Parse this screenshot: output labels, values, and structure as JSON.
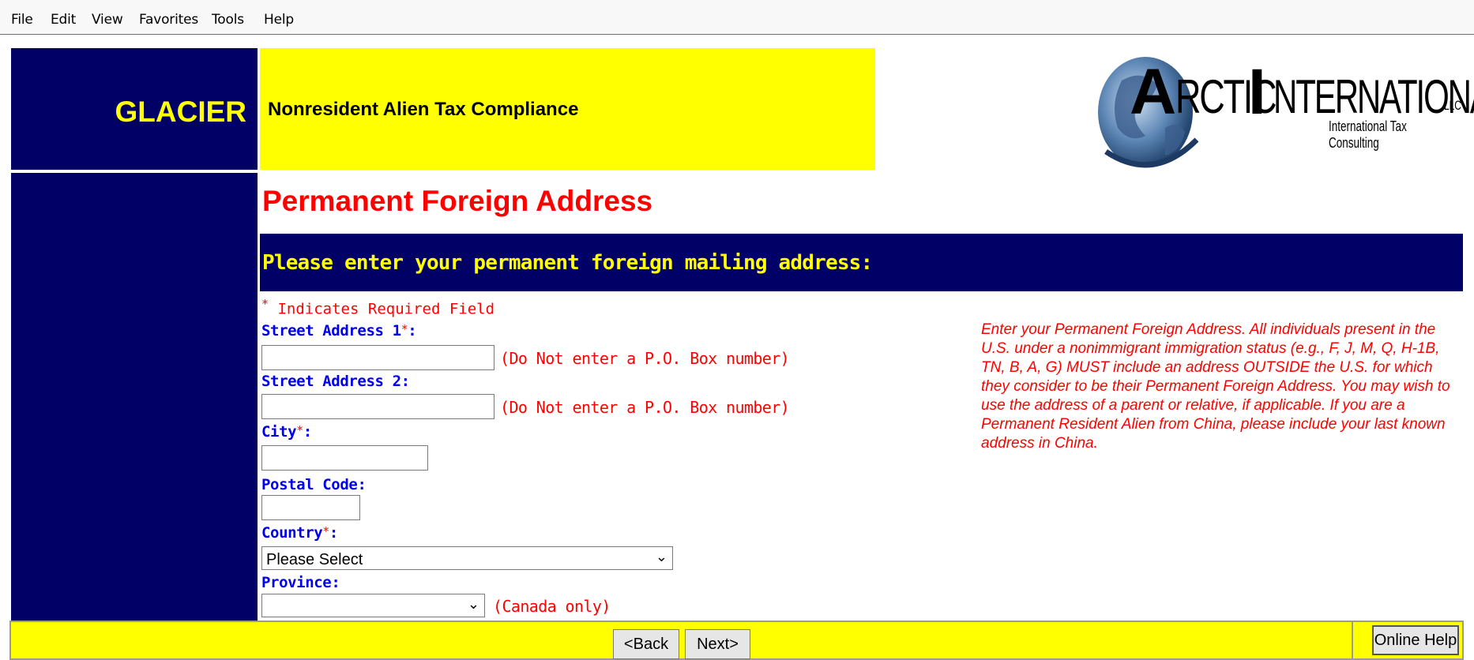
{
  "menubar": {
    "items": [
      "File",
      "Edit",
      "View",
      "Favorites",
      "Tools",
      "Help"
    ]
  },
  "header": {
    "brand": "GLACIER",
    "tagline": "Nonresident Alien Tax Compliance",
    "logo": {
      "name_big": "RCTIC",
      "name_initial_a": "A",
      "name_initial_i": "I",
      "name_rest": "NTERNATIONAL",
      "suffix": "LLC",
      "sub": "International Tax Consulting"
    }
  },
  "page": {
    "title": "Permanent Foreign Address",
    "section_heading": "Please enter your permanent foreign mailing address:",
    "required_note": "Indicates Required Field",
    "required_star": "*"
  },
  "form": {
    "street1": {
      "label": "Street Address 1",
      "required": true,
      "value": "",
      "hint": "(Do Not enter a P.O. Box number)"
    },
    "street2": {
      "label": "Street Address 2",
      "value": "",
      "hint": "(Do Not enter a P.O. Box number)"
    },
    "city": {
      "label": "City",
      "required": true,
      "value": ""
    },
    "postal": {
      "label": "Postal Code",
      "value": ""
    },
    "country": {
      "label": "Country",
      "required": true,
      "selected": "Please Select"
    },
    "province": {
      "label": "Province",
      "selected": "",
      "hint": "(Canada only)"
    }
  },
  "info": {
    "text": "Enter your Permanent Foreign Address. All individuals present in the U.S. under a nonimmigrant immigration status (e.g., F, J, M, Q, H-1B, TN, B, A, G) MUST include an address OUTSIDE the U.S. for which they consider to be their Permanent Foreign Address. You may wish to use the address of a parent or relative, if applicable. If you are a Permanent Resident Alien from China, please include your last known address in China."
  },
  "footer": {
    "back_label": "<Back",
    "next_label": "Next>",
    "help_label": "Online Help"
  },
  "colors": {
    "navy": "#000066",
    "yellow": "#ffff00",
    "required_red": "#ff0000",
    "label_blue": "#0000ee"
  }
}
